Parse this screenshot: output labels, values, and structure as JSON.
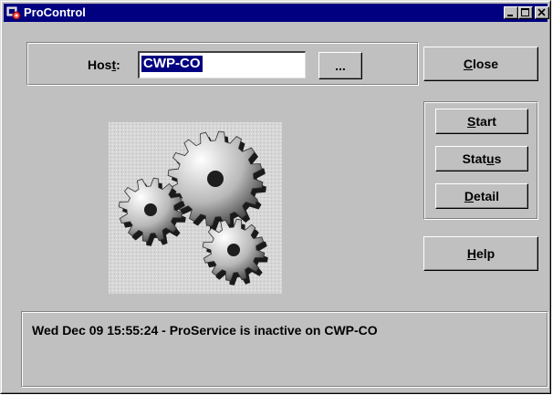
{
  "window": {
    "title": "ProControl"
  },
  "host": {
    "label_before": "Hos",
    "label_mnemonic": "t",
    "label_after": ":",
    "value": "CWP-CO",
    "browse_label": "..."
  },
  "buttons": {
    "close": {
      "mnemonic": "C",
      "rest": "lose"
    },
    "start": {
      "mnemonic": "S",
      "rest": "tart"
    },
    "status": {
      "before": "Stat",
      "mnemonic": "u",
      "after": "s"
    },
    "detail": {
      "mnemonic": "D",
      "rest": "etail"
    },
    "help": {
      "mnemonic": "H",
      "rest": "elp"
    }
  },
  "status_message": "Wed Dec 09 15:55:24 - ProService is inactive on CWP-CO",
  "colors": {
    "titlebar": "#000080",
    "face": "#c0c0c0",
    "selection": "#000080"
  }
}
